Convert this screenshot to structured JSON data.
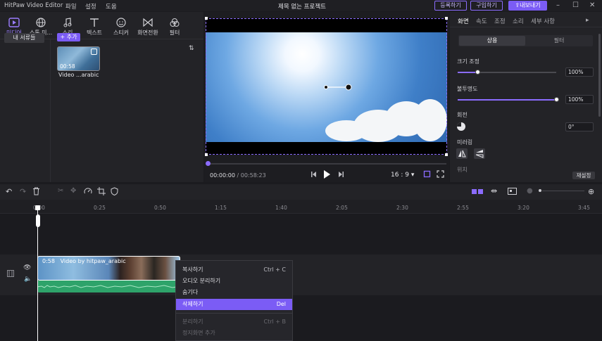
{
  "titlebar": {
    "app_name": "HitPaw Video Editor",
    "menu": [
      "파일",
      "설정",
      "도움"
    ],
    "project_title": "제목 없는 프로젝트",
    "register": "등록하기",
    "buy": "구입하기",
    "export": "내보내기"
  },
  "left_tabs": [
    {
      "label": "미디어",
      "icon": "media-icon"
    },
    {
      "label": "스톡 미...",
      "icon": "globe-icon"
    },
    {
      "label": "소리",
      "icon": "music-icon"
    },
    {
      "label": "텍스트",
      "icon": "text-icon"
    },
    {
      "label": "스티커",
      "icon": "sticker-icon"
    },
    {
      "label": "화면전환",
      "icon": "transition-icon"
    },
    {
      "label": "필터",
      "icon": "filter-icon"
    }
  ],
  "library": {
    "my_library": "내 서류들",
    "add": "+ 추가",
    "media_item": {
      "duration": "00:58",
      "name": "Video ...arabic"
    }
  },
  "player": {
    "current": "00:00:00",
    "total": "/ 00:58:23",
    "aspect": "16 : 9"
  },
  "right_tabs": [
    "화면",
    "속도",
    "조정",
    "소리",
    "세부 사항"
  ],
  "properties": {
    "segment_on": "상용",
    "segment_off": "필터",
    "scale_label": "크기 조정",
    "scale_value": "100%",
    "scale_level": 0.2,
    "opacity_label": "불투명도",
    "opacity_value": "100%",
    "opacity_level": 1.0,
    "rotate_label": "회전",
    "rotate_value": "0°",
    "mirror_label": "미러링",
    "partial_label": "위치",
    "reset": "재설정"
  },
  "timeline": {
    "ticks": [
      "0:00",
      "0:25",
      "0:50",
      "1:15",
      "1:40",
      "2:05",
      "2:30",
      "2:55",
      "3:20",
      "3:45"
    ],
    "clip_duration": "0:58",
    "clip_name": "Video by hitpaw_arabic"
  },
  "context_menu": [
    {
      "label": "복사하기",
      "shortcut": "Ctrl + C",
      "state": "normal"
    },
    {
      "label": "오디오 분리하기",
      "shortcut": "",
      "state": "normal"
    },
    {
      "label": "숨기다",
      "shortcut": "",
      "state": "normal"
    },
    {
      "label": "삭제하기",
      "shortcut": "Del",
      "state": "selected"
    },
    {
      "label": "분리하기",
      "shortcut": "Ctrl + B",
      "state": "disabled"
    },
    {
      "label": "정지화면 추가",
      "shortcut": "",
      "state": "disabled"
    }
  ],
  "colors": {
    "accent": "#7b5cf5",
    "audio_track": "#2ea36a"
  }
}
